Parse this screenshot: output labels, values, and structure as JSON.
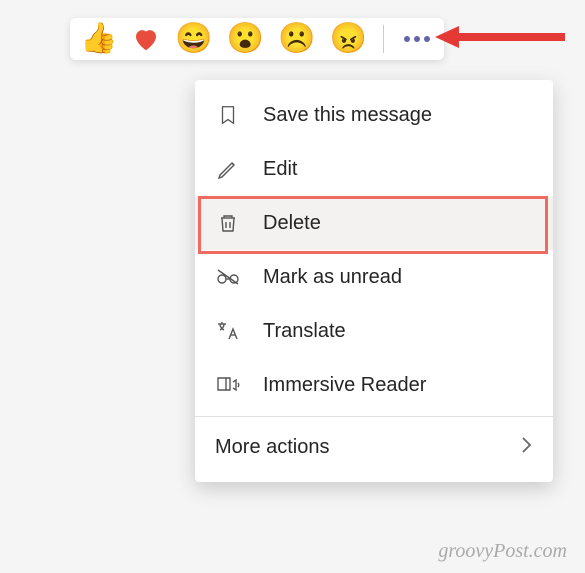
{
  "reactions": [
    "👍",
    "❤",
    "😄",
    "😮",
    "☹️",
    "😠"
  ],
  "menu": {
    "save": "Save this message",
    "edit": "Edit",
    "delete": "Delete",
    "unread": "Mark as unread",
    "translate": "Translate",
    "immersive": "Immersive Reader",
    "more": "More actions"
  },
  "watermark": "groovyPost.com"
}
